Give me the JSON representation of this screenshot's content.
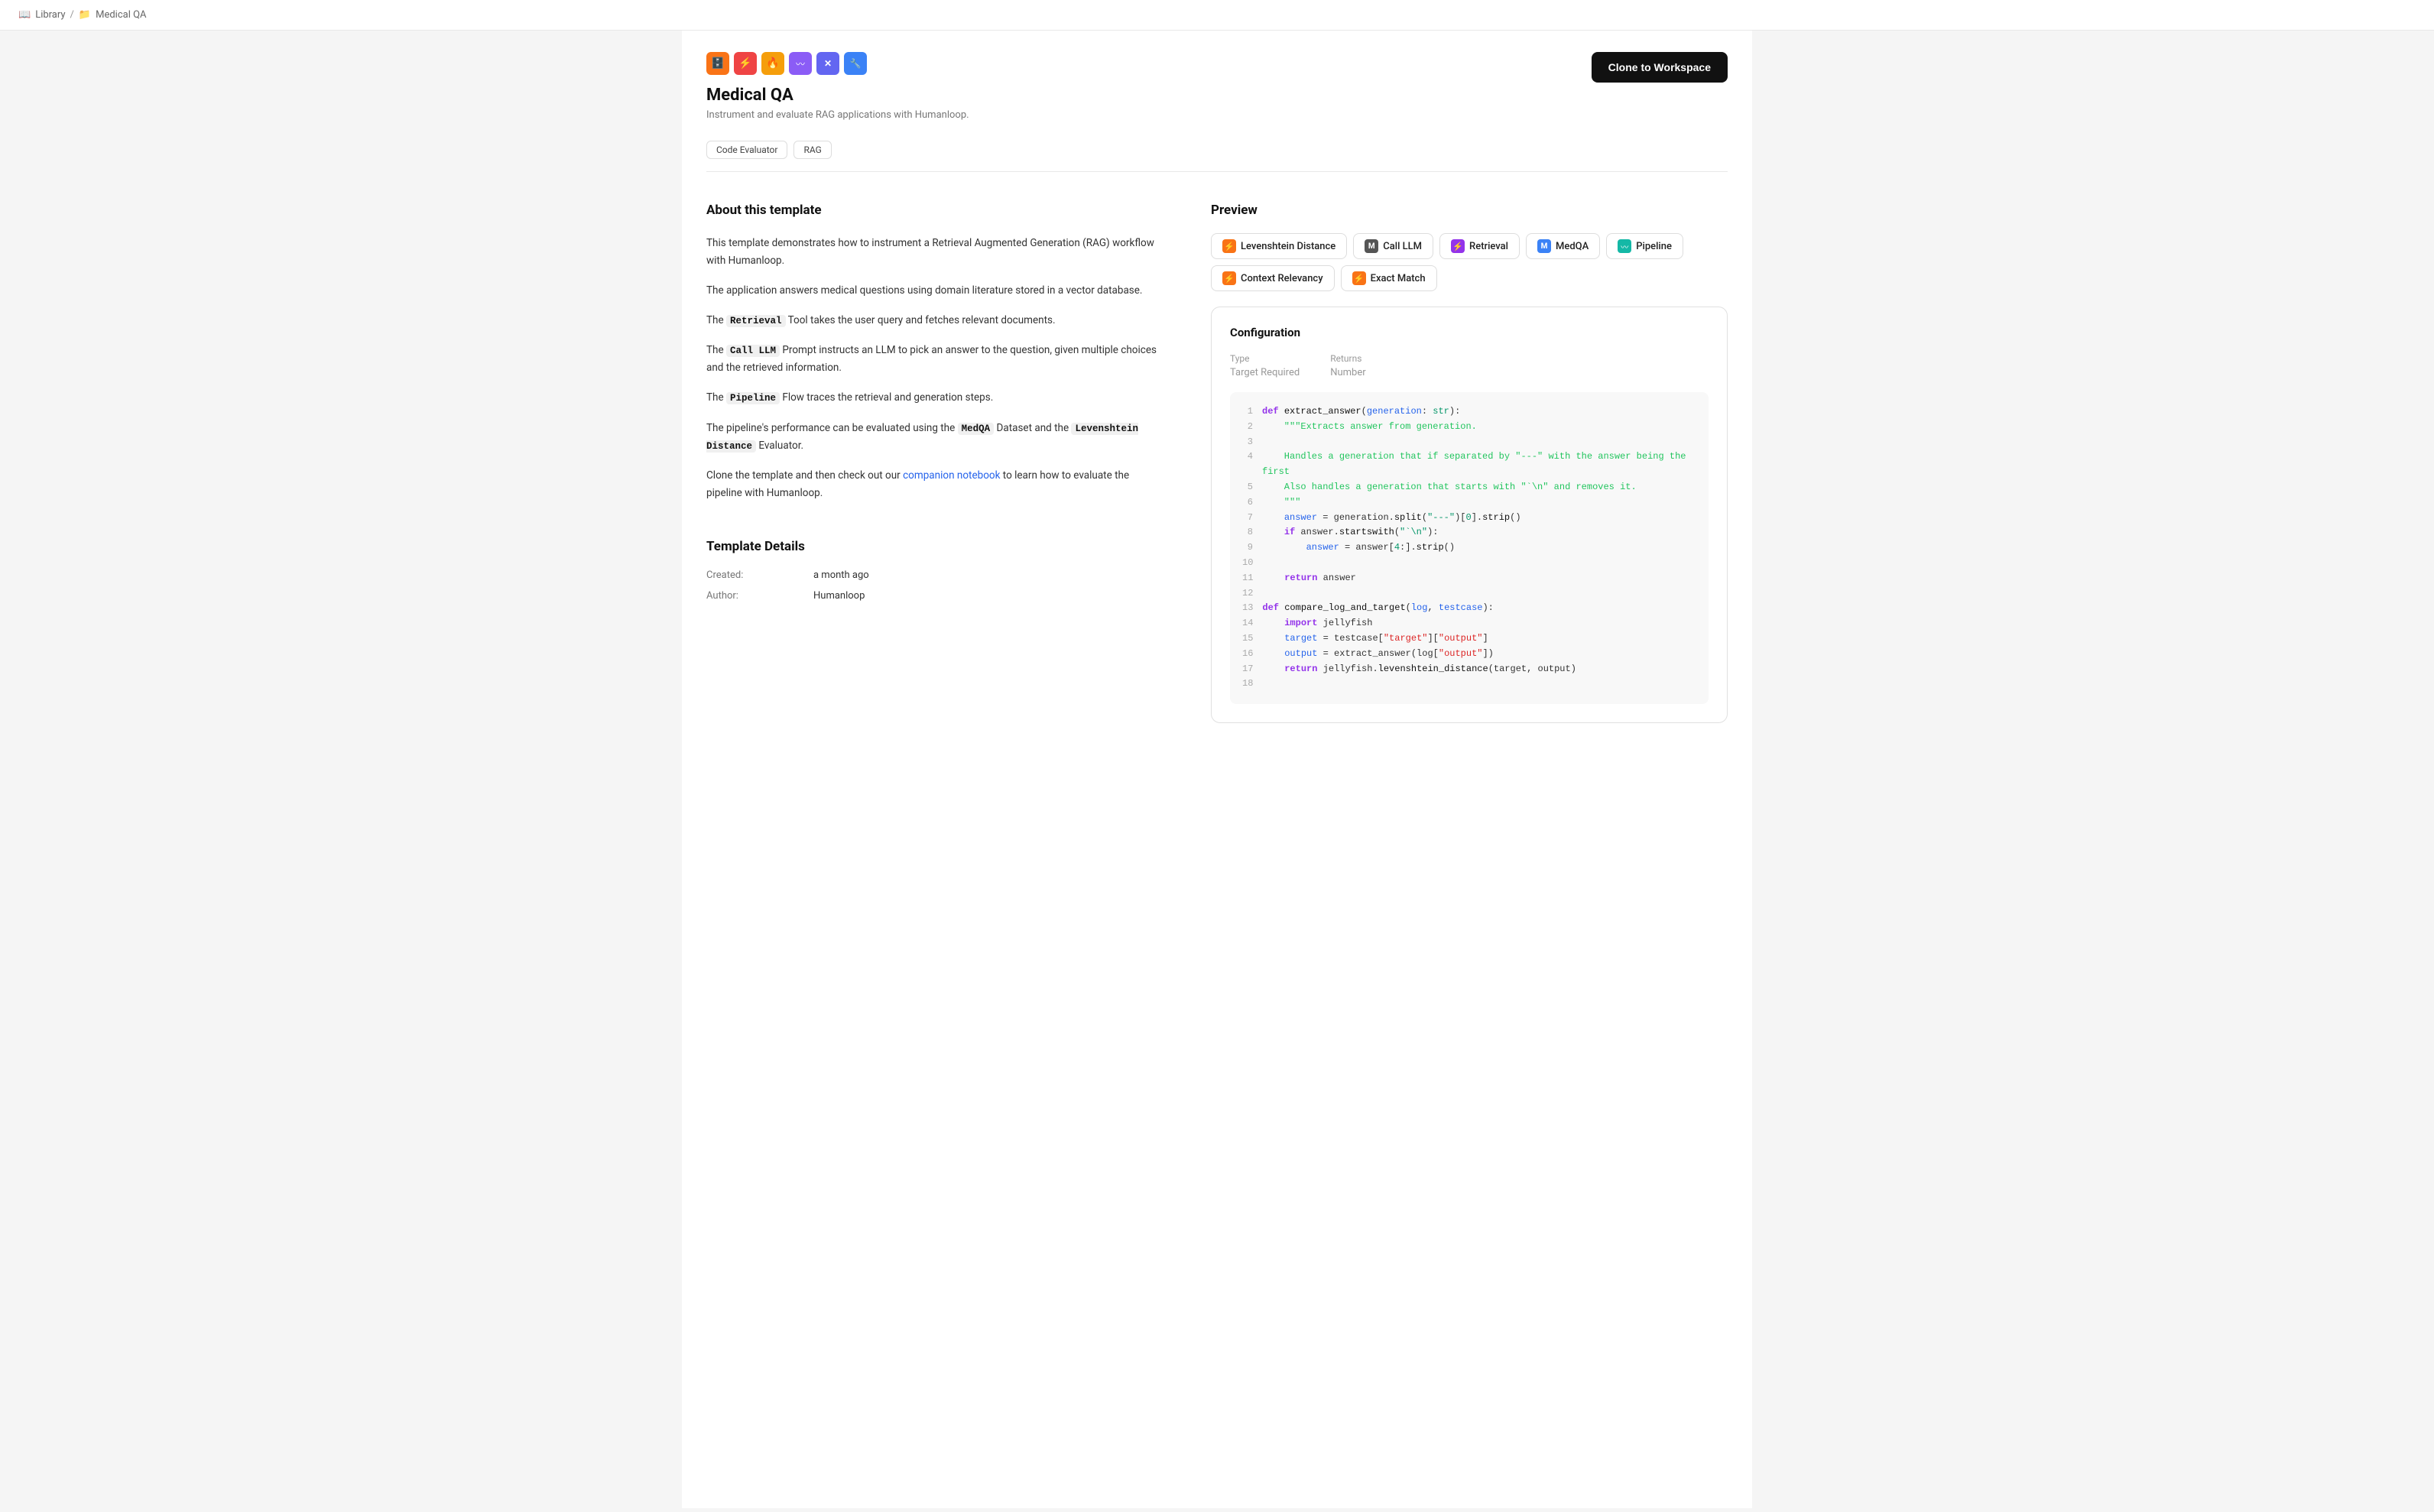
{
  "breadcrumb": {
    "items": [
      "Library",
      "Medical QA"
    ]
  },
  "header": {
    "title": "Medical QA",
    "subtitle": "Instrument and evaluate RAG applications with Humanloop.",
    "clone_button": "Clone to Workspace"
  },
  "tags": [
    "Code Evaluator",
    "RAG"
  ],
  "icons": [
    {
      "color": "#f97316",
      "symbol": "🗄"
    },
    {
      "color": "#ef4444",
      "symbol": "⚡"
    },
    {
      "color": "#f59e0b",
      "symbol": "🔥"
    },
    {
      "color": "#8b5cf6",
      "symbol": "〰"
    },
    {
      "color": "#6366f1",
      "symbol": "✕"
    },
    {
      "color": "#3b82f6",
      "symbol": "🔧"
    }
  ],
  "about": {
    "title": "About this template",
    "paragraphs": [
      "This template demonstrates how to instrument a Retrieval Augmented Generation (RAG) workflow with Humanloop.",
      "The application answers medical questions using domain literature stored in a vector database.",
      "The {Retrieval} Tool takes the user query and fetches relevant documents.",
      "The {Call LLM} Prompt instructs an LLM to pick an answer to the question, given multiple choices and the retrieved information.",
      "The {Pipeline} Flow traces the retrieval and generation steps.",
      "The pipeline's performance can be evaluated using the {MedQA} Dataset and the {Levenshtein Distance} Evaluator.",
      "Clone the template and then check out our {companion notebook} to learn how to evaluate the pipeline with Humanloop."
    ]
  },
  "template_details": {
    "title": "Template Details",
    "fields": [
      {
        "label": "Created:",
        "value": "a month ago"
      },
      {
        "label": "Author:",
        "value": "Humanloop"
      }
    ]
  },
  "preview": {
    "title": "Preview",
    "tabs": [
      {
        "label": "Levenshtein Distance",
        "icon_type": "orange",
        "icon_char": "⚡"
      },
      {
        "label": "Call LLM",
        "icon_type": "gray",
        "icon_char": "M"
      },
      {
        "label": "Retrieval",
        "icon_type": "purple",
        "icon_char": "⚡"
      },
      {
        "label": "MedQA",
        "icon_type": "blue",
        "icon_char": "M"
      },
      {
        "label": "Pipeline",
        "icon_type": "teal",
        "icon_char": "〰"
      },
      {
        "label": "Context Relevancy",
        "icon_type": "orange",
        "icon_char": "⚡"
      },
      {
        "label": "Exact Match",
        "icon_type": "orange",
        "icon_char": "⚡"
      }
    ],
    "config": {
      "title": "Configuration",
      "type_label": "Type",
      "type_value": "Target Required",
      "returns_label": "Returns",
      "returns_value": "Number"
    },
    "code_lines": [
      {
        "num": 1,
        "content": "def extract_answer(generation: str):"
      },
      {
        "num": 2,
        "content": "    \"\"\"Extracts answer from generation."
      },
      {
        "num": 3,
        "content": ""
      },
      {
        "num": 4,
        "content": "    Handles a generation that if separated by \"---\" with the answer being the first"
      },
      {
        "num": 5,
        "content": "    Also handles a generation that starts with \"`\\n\" and removes it."
      },
      {
        "num": 6,
        "content": "    \"\"\""
      },
      {
        "num": 7,
        "content": "    answer = generation.split(\"---\")[0].strip()"
      },
      {
        "num": 8,
        "content": "    if answer.startswith(\"`\\n\"):"
      },
      {
        "num": 9,
        "content": "        answer = answer[4:].strip()"
      },
      {
        "num": 10,
        "content": ""
      },
      {
        "num": 11,
        "content": "    return answer"
      },
      {
        "num": 12,
        "content": ""
      },
      {
        "num": 13,
        "content": "def compare_log_and_target(log, testcase):"
      },
      {
        "num": 14,
        "content": "    import jellyfish"
      },
      {
        "num": 15,
        "content": "    target = testcase[\"target\"][\"output\"]"
      },
      {
        "num": 16,
        "content": "    output = extract_answer(log[\"output\"])"
      },
      {
        "num": 17,
        "content": "    return jellyfish.levenshtein_distance(target, output)"
      },
      {
        "num": 18,
        "content": ""
      }
    ]
  }
}
